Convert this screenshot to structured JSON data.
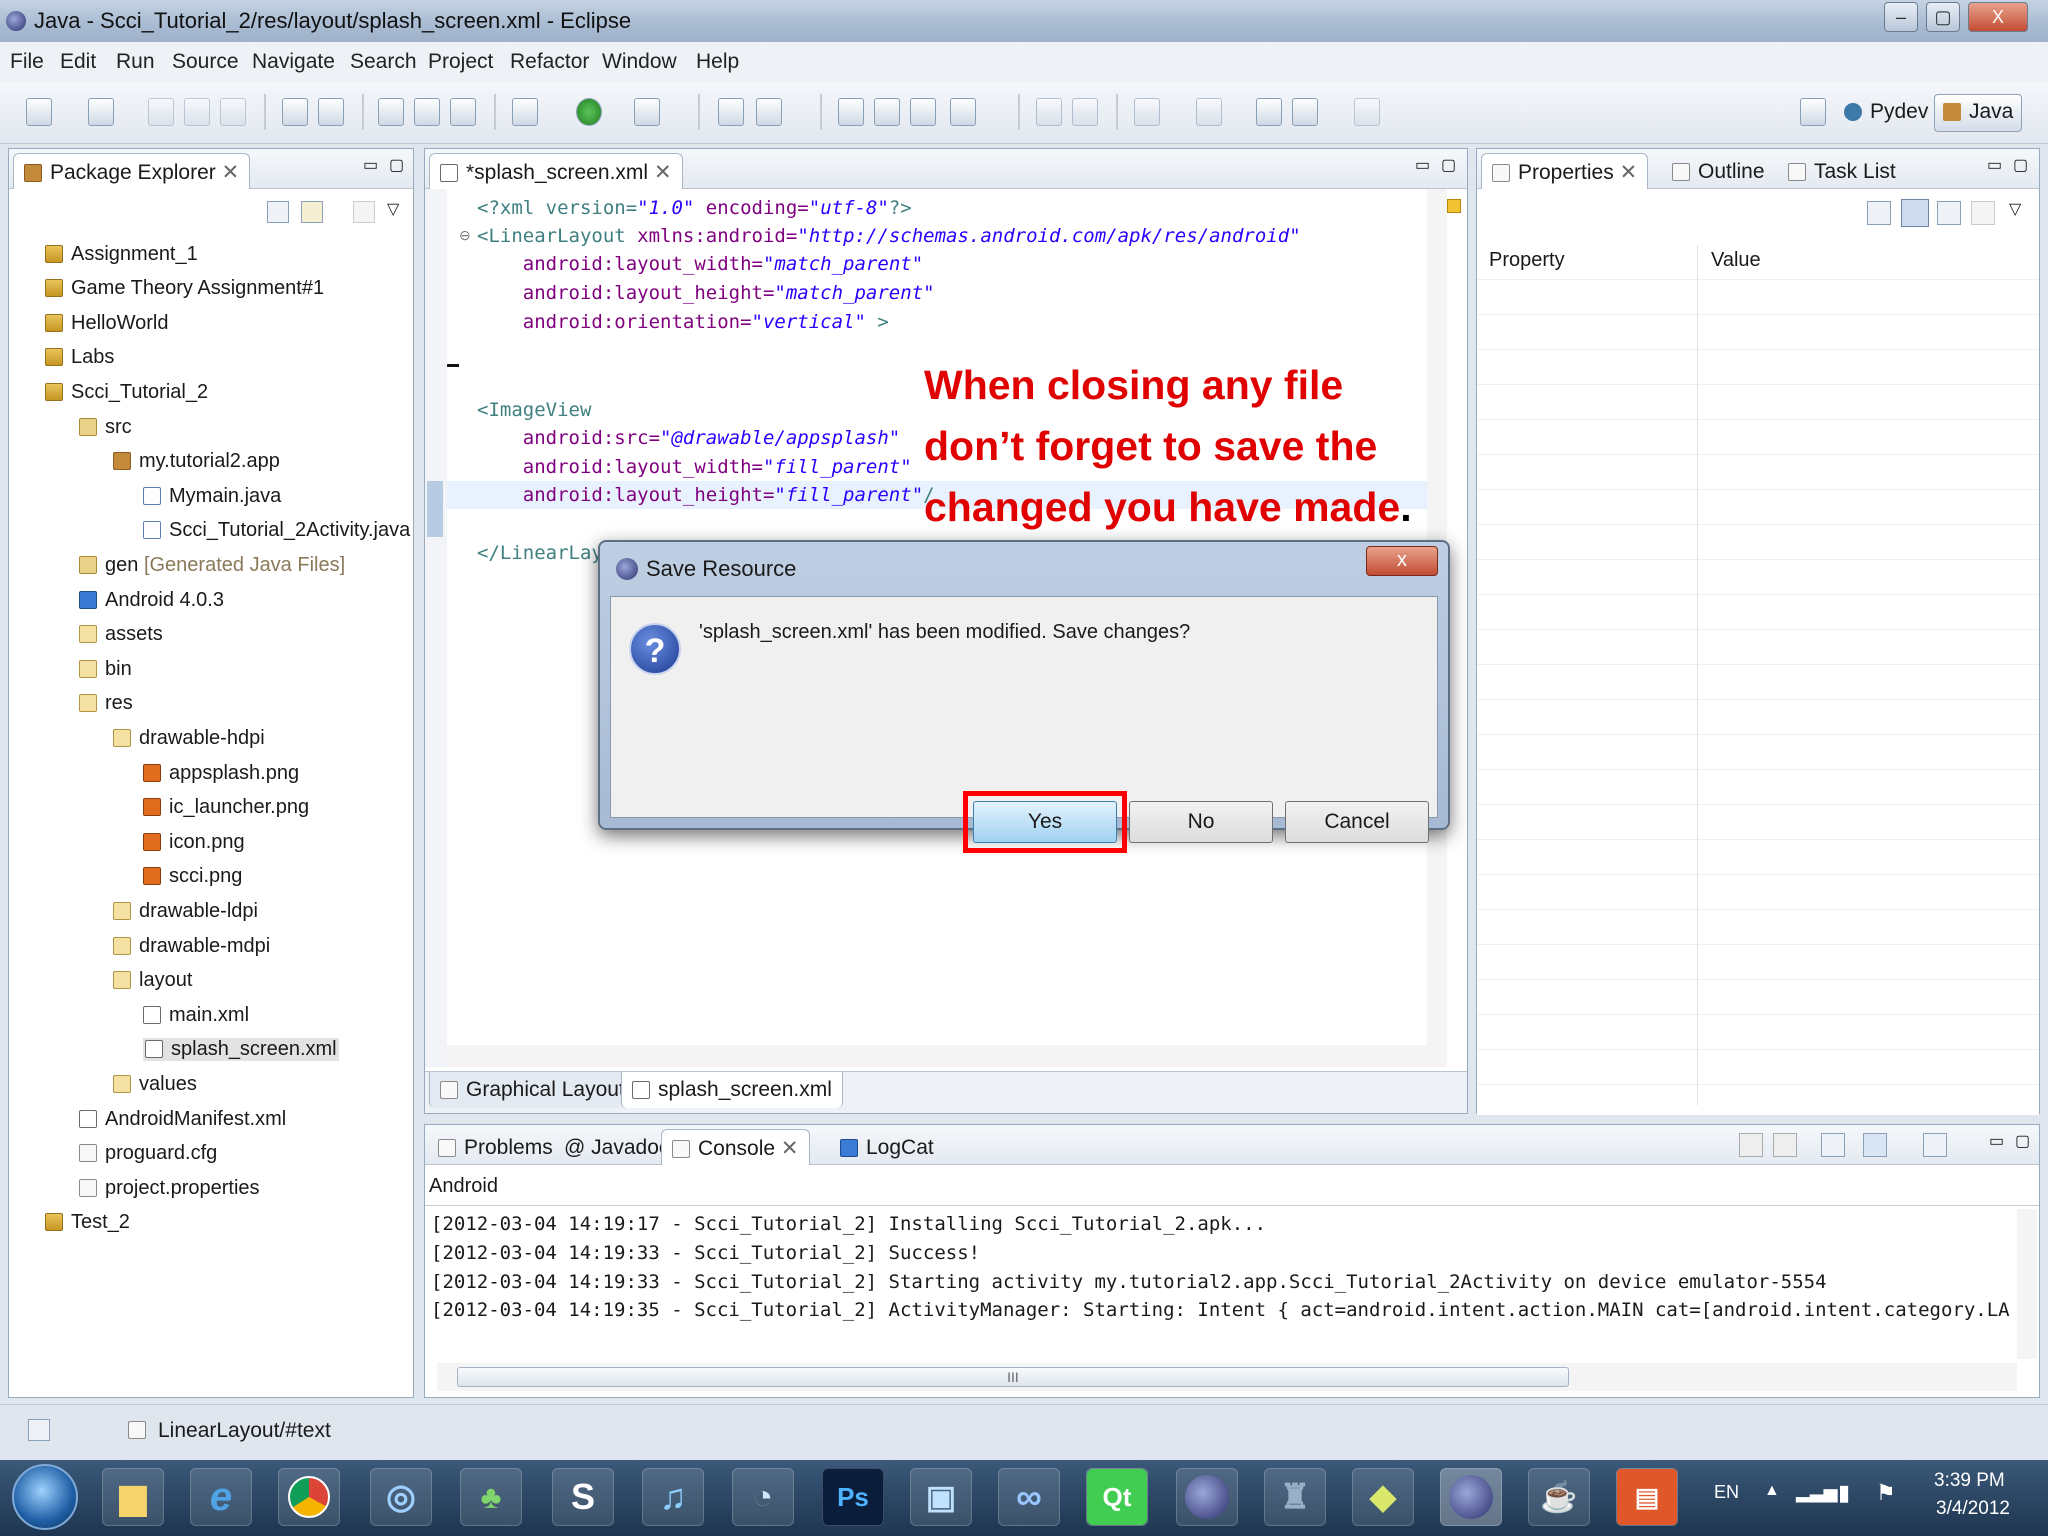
{
  "window": {
    "title": "Java - Scci_Tutorial_2/res/layout/splash_screen.xml - Eclipse",
    "minimize": "–",
    "maximize": "▢",
    "close": "X"
  },
  "menu": [
    "File",
    "Edit",
    "Run",
    "Source",
    "Navigate",
    "Search",
    "Project",
    "Refactor",
    "Window",
    "Help"
  ],
  "perspectives": {
    "pydev": "Pydev",
    "java": "Java"
  },
  "package_explorer": {
    "title": "Package Explorer",
    "items": [
      {
        "label": "Assignment_1",
        "icon": "project"
      },
      {
        "label": "Game Theory Assignment#1",
        "icon": "project"
      },
      {
        "label": "HelloWorld",
        "icon": "project"
      },
      {
        "label": "Labs",
        "icon": "project"
      },
      {
        "label": "Scci_Tutorial_2",
        "icon": "project"
      },
      {
        "label": "src",
        "icon": "source-folder"
      },
      {
        "label": "my.tutorial2.app",
        "icon": "package"
      },
      {
        "label": "Mymain.java",
        "icon": "java-file"
      },
      {
        "label": "Scci_Tutorial_2Activity.java",
        "icon": "java-file"
      },
      {
        "label": "gen",
        "suffix": "[Generated Java Files]",
        "icon": "source-folder"
      },
      {
        "label": "Android 4.0.3",
        "icon": "library"
      },
      {
        "label": "assets",
        "icon": "folder"
      },
      {
        "label": "bin",
        "icon": "folder"
      },
      {
        "label": "res",
        "icon": "folder"
      },
      {
        "label": "drawable-hdpi",
        "icon": "folder"
      },
      {
        "label": "appsplash.png",
        "icon": "image"
      },
      {
        "label": "ic_launcher.png",
        "icon": "image"
      },
      {
        "label": "icon.png",
        "icon": "image"
      },
      {
        "label": "scci.png",
        "icon": "image"
      },
      {
        "label": "drawable-ldpi",
        "icon": "folder"
      },
      {
        "label": "drawable-mdpi",
        "icon": "folder"
      },
      {
        "label": "layout",
        "icon": "folder"
      },
      {
        "label": "main.xml",
        "icon": "xml-file"
      },
      {
        "label": "splash_screen.xml",
        "icon": "xml-file"
      },
      {
        "label": "values",
        "icon": "folder"
      },
      {
        "label": "AndroidManifest.xml",
        "icon": "xml-file"
      },
      {
        "label": "proguard.cfg",
        "icon": "file"
      },
      {
        "label": "project.properties",
        "icon": "file"
      },
      {
        "label": "Test_2",
        "icon": "project"
      }
    ]
  },
  "editor": {
    "tab": "*splash_screen.xml",
    "lines": [
      {
        "t": "<?xml version=",
        "v": "\"1.0\"",
        "t2": " encoding=",
        "v2": "\"utf-8\"",
        "t3": "?>"
      },
      {
        "tag": "<LinearLayout",
        "attr": " xmlns:android=",
        "val": "\"http://schemas.android.com/apk/res/android\""
      },
      {
        "attr": "    android:layout_width=",
        "val": "\"match_parent\""
      },
      {
        "attr": "    android:layout_height=",
        "val": "\"match_parent\""
      },
      {
        "attr": "    android:orientation=",
        "val": "\"vertical\"",
        "tag2": " >"
      },
      {
        "tag": "<ImageView"
      },
      {
        "attr": "    android:src=",
        "val": "\"@drawable/appsplash\""
      },
      {
        "attr": "    android:layout_width=",
        "val": "\"fill_parent\""
      },
      {
        "attr": "    android:layout_height=",
        "val": "\"fill_parent\"",
        "tag2": "/"
      },
      {
        "tag": "</LinearLay"
      }
    ],
    "bottom_tabs": [
      "Graphical Layout",
      "splash_screen.xml"
    ]
  },
  "annotation": {
    "lines": [
      "When closing any file",
      "don’t forget to save the",
      "changed you have made"
    ],
    "period": "."
  },
  "dialog": {
    "title": "Save Resource",
    "message": "'splash_screen.xml' has been modified. Save changes?",
    "yes": "Yes",
    "no": "No",
    "cancel": "Cancel",
    "close": "x"
  },
  "properties": {
    "tabs": [
      "Properties",
      "Outline",
      "Task List"
    ],
    "col_property": "Property",
    "col_value": "Value"
  },
  "console": {
    "tabs": [
      "Problems",
      "Javadoc",
      "Console",
      "LogCat"
    ],
    "label": "Android",
    "lines": [
      "[2012-03-04 14:19:17 - Scci_Tutorial_2] Installing Scci_Tutorial_2.apk...",
      "[2012-03-04 14:19:33 - Scci_Tutorial_2] Success!",
      "[2012-03-04 14:19:33 - Scci_Tutorial_2] Starting activity my.tutorial2.app.Scci_Tutorial_2Activity on device emulator-5554",
      "[2012-03-04 14:19:35 - Scci_Tutorial_2] ActivityManager: Starting: Intent { act=android.intent.action.MAIN cat=[android.intent.category.LAUNC"
    ],
    "scroll_thumb": "III"
  },
  "statusbar": {
    "text": "LinearLayout/#text"
  },
  "taskbar": {
    "lang": "EN",
    "time": "3:39 PM",
    "date": "3/4/2012",
    "apps": [
      {
        "name": "start-orb"
      },
      {
        "name": "explorer"
      },
      {
        "name": "internet-explorer"
      },
      {
        "name": "chrome"
      },
      {
        "name": "safari"
      },
      {
        "name": "messenger"
      },
      {
        "name": "skype",
        "glyph": "S"
      },
      {
        "name": "itunes"
      },
      {
        "name": "sidebar"
      },
      {
        "name": "photoshop",
        "glyph": "Ps"
      },
      {
        "name": "picture-viewer"
      },
      {
        "name": "infinity-app"
      },
      {
        "name": "qt",
        "glyph": "Qt"
      },
      {
        "name": "eclipse"
      },
      {
        "name": "castle-app"
      },
      {
        "name": "folder-app"
      },
      {
        "name": "eclipse-active"
      },
      {
        "name": "java-app"
      },
      {
        "name": "office-app"
      }
    ]
  }
}
